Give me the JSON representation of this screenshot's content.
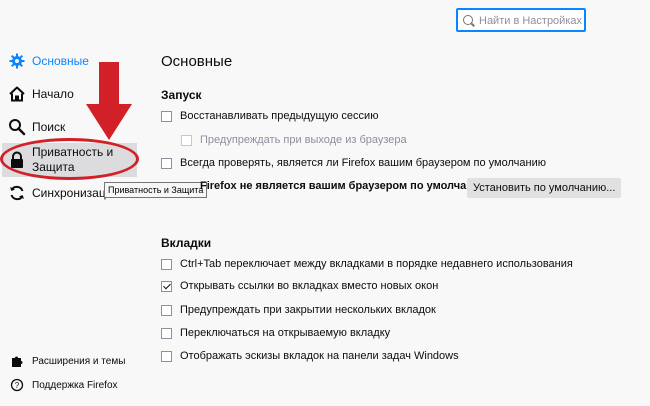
{
  "search": {
    "placeholder": "Найти в Настройках"
  },
  "sidebar": {
    "items": [
      {
        "label": "Основные",
        "icon": "gear-icon",
        "selected": true
      },
      {
        "label": "Начало",
        "icon": "home-icon"
      },
      {
        "label": "Поиск",
        "icon": "search-icon"
      },
      {
        "label": "Приватность и Защита",
        "icon": "lock-icon"
      },
      {
        "label": "Синхронизация",
        "icon": "sync-icon"
      }
    ],
    "tooltip": "Приватность и Защита",
    "footer": [
      {
        "label": "Расширения и темы",
        "icon": "puzzle-icon"
      },
      {
        "label": "Поддержка Firefox",
        "icon": "help-icon"
      }
    ]
  },
  "main": {
    "title": "Основные",
    "startup": {
      "heading": "Запуск",
      "restore_session": "Восстанавливать предыдущую сессию",
      "warn_on_quit": "Предупреждать при выходе из браузера",
      "always_check_default": "Всегда проверять, является ли Firefox вашим браузером по умолчанию",
      "not_default": "Firefox не является вашим браузером по умолчанию",
      "set_default_button": "Установить по умолчанию..."
    },
    "tabs": {
      "heading": "Вкладки",
      "items": [
        {
          "label": "Ctrl+Tab переключает между вкладками в порядке недавнего использования",
          "checked": false
        },
        {
          "label": "Открывать ссылки во вкладках вместо новых окон",
          "checked": true
        },
        {
          "label": "Предупреждать при закрытии нескольких вкладок",
          "checked": false
        },
        {
          "label": "Переключаться на открываемую вкладку",
          "checked": false
        },
        {
          "label": "Отображать эскизы вкладок на панели задач Windows",
          "checked": false
        }
      ]
    }
  },
  "colors": {
    "accent": "#0a84ff",
    "annotation": "#d12027"
  }
}
